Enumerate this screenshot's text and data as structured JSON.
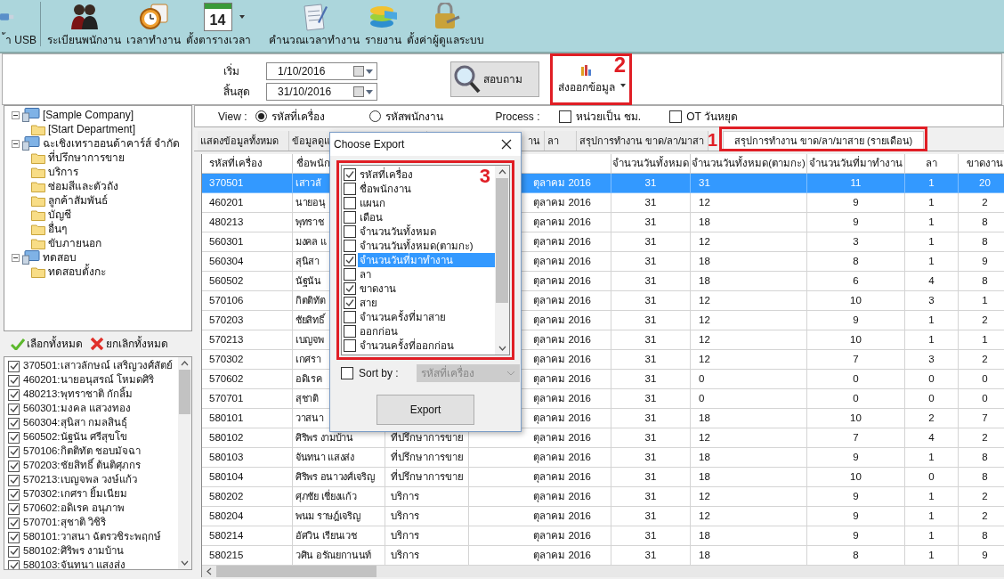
{
  "toolbar": {
    "items": [
      {
        "label": "้า USB",
        "kind": "usb",
        "dropdown": false
      },
      {
        "label": "ระเบียนพนักงาน",
        "kind": "people",
        "dropdown": false
      },
      {
        "label": "เวลาทำงาน",
        "kind": "clock",
        "dropdown": false
      },
      {
        "label": "ตั้งตารางเวลา",
        "kind": "calendar",
        "icon_text": "14",
        "dropdown": true
      },
      {
        "label": "คำนวณเวลาทำงาน",
        "kind": "notepad",
        "dropdown": false
      },
      {
        "label": "รายงาน",
        "kind": "disks",
        "dropdown": false
      },
      {
        "label": "ตั้งค่าผู้ดูแลระบบ",
        "kind": "keys",
        "dropdown": false
      }
    ]
  },
  "query": {
    "start_label": "เริ่ม",
    "start": "1/10/2016",
    "end_label": "สิ้นสุด",
    "end": "31/10/2016",
    "search_button": "สอบถาม",
    "export_button": {
      "label": "ส่งออกข้อมูล",
      "marker": "2"
    }
  },
  "tree": [
    {
      "label": "[Sample Company]",
      "kind": "computer",
      "children": [
        {
          "label": "[Start Department]",
          "kind": "folder"
        }
      ]
    },
    {
      "label": "ฉะเชิงเทราฮอนด้าคาร์ส์ จำกัด",
      "kind": "computer",
      "children": [
        {
          "label": "ที่ปรึกษาการขาย",
          "kind": "folder"
        },
        {
          "label": "บริการ",
          "kind": "folder"
        },
        {
          "label": "ซ่อมสีและตัวถัง",
          "kind": "folder"
        },
        {
          "label": "ลูกค้าสัมพันธ์",
          "kind": "folder"
        },
        {
          "label": "บัญชี",
          "kind": "folder"
        },
        {
          "label": "อื่นๆ",
          "kind": "folder"
        },
        {
          "label": "ขับภายนอก",
          "kind": "folder"
        }
      ]
    },
    {
      "label": "ทดสอบ",
      "kind": "computer",
      "children": [
        {
          "label": "ทดสอบตั้งกะ",
          "kind": "folder"
        }
      ]
    }
  ],
  "select_all": "เลือกทั้งหมด",
  "deselect_all": "ยกเลิกทั้งหมด",
  "employees": [
    {
      "label": "370501:เสาวลักษณ์ เสริญวงศ์สัตย์",
      "checked": true
    },
    {
      "label": "460201:นายอนุสรณ์ โหมดศิริ",
      "checked": true
    },
    {
      "label": "480213:พุทราชาติ  กักลิ้ม",
      "checked": true
    },
    {
      "label": "560301:มงคล แสวงทอง",
      "checked": true
    },
    {
      "label": "560304:สุนิสา  กมลสินธุ์",
      "checked": true
    },
    {
      "label": "560502:นัฐนัน  ศรีสุขโข",
      "checked": true
    },
    {
      "label": "570106:กิตติทัต ชอบมัจฉา",
      "checked": true
    },
    {
      "label": "570203:ชัยสิทธิ์ ต้นติศุภกร",
      "checked": true
    },
    {
      "label": "570213:เบญจพล วงษ์แก้ว",
      "checked": true
    },
    {
      "label": "570302:เกศรา ยิ้มเนียม",
      "checked": true
    },
    {
      "label": "570602:อดิเรค อนุภาพ",
      "checked": true
    },
    {
      "label": "570701:สุชาติ วิชิริ",
      "checked": true
    },
    {
      "label": "580101:วาสนา  ฉัตรวชิระพฤกษ์",
      "checked": true
    },
    {
      "label": "580102:ศิริพร งามบ้าน",
      "checked": true
    },
    {
      "label": "580103:จันทนา  แสงส่ง",
      "checked": true
    }
  ],
  "view": {
    "label": "View :",
    "options": [
      {
        "label": "รหัสที่เครื่อง",
        "selected": true
      },
      {
        "label": "รหัสพนักงาน",
        "selected": false
      }
    ]
  },
  "process": {
    "label": "Process :",
    "options": [
      {
        "label": "หน่วยเป็น ชม.",
        "checked": false
      },
      {
        "label": "OT วันหยุด",
        "checked": false
      }
    ]
  },
  "tabs": [
    {
      "label": "แสดงข้อมูลทั้งหมด",
      "selected": false
    },
    {
      "label": "ข้อมูลดูแ",
      "selected": false
    },
    {
      "label": "าน",
      "selected": false
    },
    {
      "label": "ลา",
      "selected": false
    },
    {
      "label": "สรุปการทำงาน ขาด/ลา/มาสา",
      "selected": false
    },
    {
      "label": "สรุปการทำงาน ขาด/ลา/มาสาย (รายเดือน)",
      "selected": true,
      "marker": "1"
    }
  ],
  "table": {
    "columns": [
      "รหัสที่เครื่อง",
      "ชื่อพนัก",
      null,
      null,
      "จำนวนวันทั้งหมด",
      "จำนวนวันทั้งหมด(ตามกะ)",
      "จำนวนวันที่มาทำงาน",
      "ลา",
      "ขาดงาน"
    ],
    "rows": [
      {
        "selected": true,
        "cells": [
          "370501",
          "เสาวลั",
          null,
          "ตุลาคม 2016",
          "31",
          "31",
          "11",
          "1",
          "20"
        ]
      },
      {
        "selected": false,
        "cells": [
          "460201",
          "นายอนุ",
          null,
          "ตุลาคม 2016",
          "31",
          "12",
          "9",
          "1",
          "2"
        ]
      },
      {
        "selected": false,
        "cells": [
          "480213",
          "พุทราช",
          null,
          "ตุลาคม 2016",
          "31",
          "18",
          "9",
          "1",
          "8"
        ]
      },
      {
        "selected": false,
        "cells": [
          "560301",
          "มงคล แ",
          null,
          "ตุลาคม 2016",
          "31",
          "12",
          "3",
          "1",
          "8"
        ]
      },
      {
        "selected": false,
        "cells": [
          "560304",
          "สุนิสา",
          null,
          "ตุลาคม 2016",
          "31",
          "18",
          "8",
          "1",
          "9"
        ]
      },
      {
        "selected": false,
        "cells": [
          "560502",
          "นัฐนัน",
          null,
          "ตุลาคม 2016",
          "31",
          "18",
          "6",
          "4",
          "8"
        ]
      },
      {
        "selected": false,
        "cells": [
          "570106",
          "กิตติทัต",
          null,
          "ตุลาคม 2016",
          "31",
          "12",
          "10",
          "3",
          "1"
        ]
      },
      {
        "selected": false,
        "cells": [
          "570203",
          "ชัยสิทธิ์",
          null,
          "ตุลาคม 2016",
          "31",
          "12",
          "9",
          "1",
          "2"
        ]
      },
      {
        "selected": false,
        "cells": [
          "570213",
          "เบญจพ",
          null,
          "ตุลาคม 2016",
          "31",
          "12",
          "10",
          "1",
          "1"
        ]
      },
      {
        "selected": false,
        "cells": [
          "570302",
          "เกศรา",
          null,
          "ตุลาคม 2016",
          "31",
          "12",
          "7",
          "3",
          "2"
        ]
      },
      {
        "selected": false,
        "cells": [
          "570602",
          "อดิเรค",
          null,
          "ตุลาคม 2016",
          "31",
          "0",
          "0",
          "0",
          "0"
        ]
      },
      {
        "selected": false,
        "cells": [
          "570701",
          "สุชาติ",
          null,
          "ตุลาคม 2016",
          "31",
          "0",
          "0",
          "0",
          "0"
        ]
      },
      {
        "selected": false,
        "cells": [
          "580101",
          "วาสนา",
          null,
          "ตุลาคม 2016",
          "31",
          "18",
          "10",
          "2",
          "7"
        ]
      },
      {
        "selected": false,
        "cells": [
          "580102",
          "ศิริพร งามบ้าน",
          "ที่ปรึกษาการขาย",
          "ตุลาคม 2016",
          "31",
          "12",
          "7",
          "4",
          "2"
        ]
      },
      {
        "selected": false,
        "cells": [
          "580103",
          "จันทนา  แสงส่ง",
          "ที่ปรึกษาการขาย",
          "ตุลาคม 2016",
          "31",
          "18",
          "9",
          "1",
          "8"
        ]
      },
      {
        "selected": false,
        "cells": [
          "580104",
          "ศิริพร  อนาวงศ์เจริญ",
          "ที่ปรึกษาการขาย",
          "ตุลาคม 2016",
          "31",
          "18",
          "10",
          "0",
          "8"
        ]
      },
      {
        "selected": false,
        "cells": [
          "580202",
          "ศุภชัย เชี่ยงแก้ว",
          "บริการ",
          "ตุลาคม 2016",
          "31",
          "12",
          "9",
          "1",
          "2"
        ]
      },
      {
        "selected": false,
        "cells": [
          "580204",
          "พนม ราษฎ์เจริญ",
          "บริการ",
          "ตุลาคม 2016",
          "31",
          "12",
          "9",
          "1",
          "2"
        ]
      },
      {
        "selected": false,
        "cells": [
          "580214",
          "อัศวิน  เรียนเวช",
          "บริการ",
          "ตุลาคม 2016",
          "31",
          "18",
          "9",
          "1",
          "8"
        ]
      },
      {
        "selected": false,
        "cells": [
          "580215",
          "วศิน  อรัณยกานนท์",
          "บริการ",
          "ตุลาคม 2016",
          "31",
          "18",
          "8",
          "1",
          "9"
        ]
      }
    ]
  },
  "dialog": {
    "title": "Choose Export",
    "marker": "3",
    "fields": [
      {
        "label": "รหัสที่เครื่อง",
        "checked": true,
        "selected": false
      },
      {
        "label": "ชื่อพนักงาน",
        "checked": false,
        "selected": false
      },
      {
        "label": "แผนก",
        "checked": false,
        "selected": false
      },
      {
        "label": "เดือน",
        "checked": false,
        "selected": false
      },
      {
        "label": "จำนวนวันทั้งหมด",
        "checked": false,
        "selected": false
      },
      {
        "label": "จำนวนวันทั้งหมด(ตามกะ)",
        "checked": false,
        "selected": false
      },
      {
        "label": "จำนวนวันที่มาทำงาน",
        "checked": true,
        "selected": true
      },
      {
        "label": "ลา",
        "checked": false,
        "selected": false
      },
      {
        "label": "ขาดงาน",
        "checked": true,
        "selected": false
      },
      {
        "label": "สาย",
        "checked": true,
        "selected": false
      },
      {
        "label": "จำนวนครั้งที่มาสาย",
        "checked": false,
        "selected": false
      },
      {
        "label": "ออกก่อน",
        "checked": false,
        "selected": false
      },
      {
        "label": "จำนวนครั้งที่ออกก่อน",
        "checked": false,
        "selected": false
      }
    ],
    "sort_by": {
      "label": "Sort by :",
      "checked": false,
      "value": "รหัสที่เครื่อง",
      "disabled": true
    },
    "export_button": "Export"
  }
}
